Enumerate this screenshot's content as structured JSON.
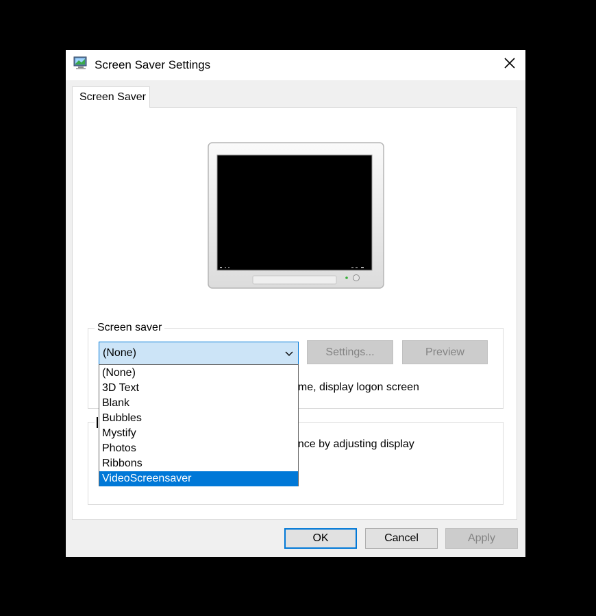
{
  "window": {
    "title": "Screen Saver Settings",
    "close_glyph": "✕"
  },
  "tabs": [
    {
      "label": "Screen Saver"
    }
  ],
  "screen_saver_group": {
    "label": "Screen saver",
    "combo": {
      "selected_value": "(None)"
    },
    "settings_button": "Settings...",
    "preview_button": "Preview",
    "resume_text_visible": "ume, display logon screen"
  },
  "dropdown": {
    "options": [
      "(None)",
      "3D Text",
      "Blank",
      "Bubbles",
      "Mystify",
      "Photos",
      "Ribbons",
      "VideoScreensaver"
    ],
    "highlighted": "VideoScreensaver"
  },
  "power_group": {
    "text_visible": "ance by adjusting display"
  },
  "footer": {
    "ok": "OK",
    "cancel": "Cancel",
    "apply": "Apply"
  },
  "colors": {
    "accent": "#0078d7",
    "link": "#0a5fcc",
    "selection_bg": "#0078d7",
    "combo_bg": "#cce4f7"
  },
  "icons": {
    "title": "screen-saver-monitor-icon",
    "close": "close-icon",
    "chevron": "chevron-down-icon"
  }
}
